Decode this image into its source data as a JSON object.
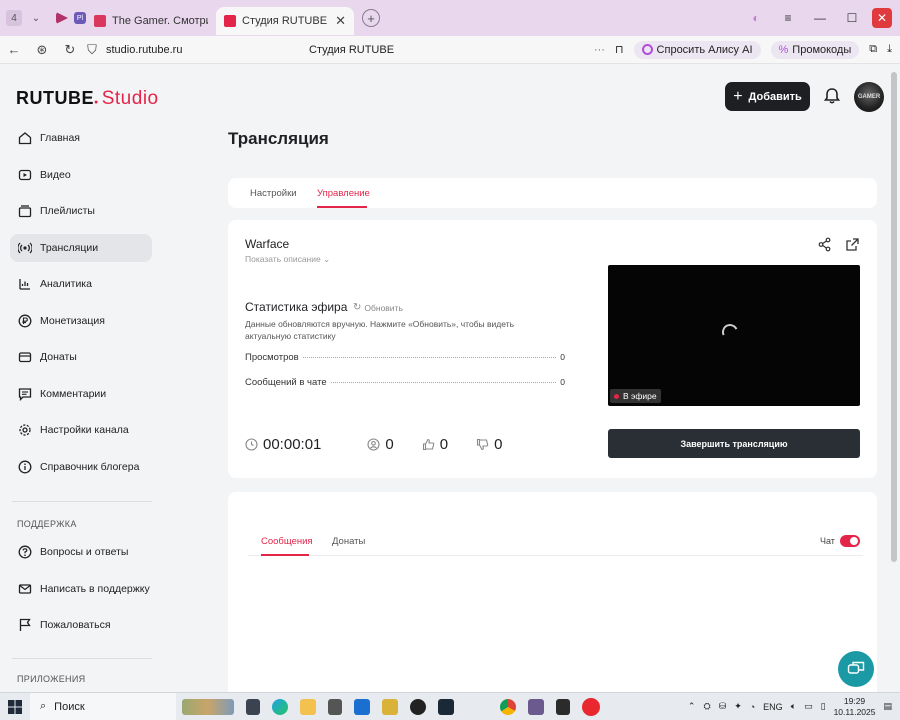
{
  "browser": {
    "tab_count": "4",
    "tabs": [
      {
        "title": "The Gamer. Смотрите вид",
        "color": "#d9385c"
      },
      {
        "title": "Студия RUTUBE",
        "color": "#e4254a"
      }
    ],
    "url": "studio.rutube.ru",
    "page_title": "Студия RUTUBE",
    "alice_label": "Спросить Алису AI",
    "promo_label": "Промокоды"
  },
  "header": {
    "logo_main": "RUTUBE",
    "logo_studio": "Studio",
    "add_button": "Добавить",
    "avatar_text": "GAMER"
  },
  "sidebar": {
    "items": [
      {
        "label": "Главная",
        "icon": "home-icon"
      },
      {
        "label": "Видео",
        "icon": "video-icon"
      },
      {
        "label": "Плейлисты",
        "icon": "playlist-icon"
      },
      {
        "label": "Трансляции",
        "icon": "broadcast-icon",
        "active": true
      },
      {
        "label": "Аналитика",
        "icon": "analytics-icon"
      },
      {
        "label": "Монетизация",
        "icon": "ruble-icon"
      },
      {
        "label": "Донаты",
        "icon": "donate-icon"
      },
      {
        "label": "Комментарии",
        "icon": "comment-icon"
      },
      {
        "label": "Настройки канала",
        "icon": "gear-icon"
      },
      {
        "label": "Справочник блогера",
        "icon": "info-icon"
      }
    ],
    "support_title": "ПОДДЕРЖКА",
    "support_items": [
      {
        "label": "Вопросы и ответы",
        "icon": "help-icon"
      },
      {
        "label": "Написать в поддержку",
        "icon": "mail-icon"
      },
      {
        "label": "Пожаловаться",
        "icon": "flag-icon"
      }
    ],
    "apps_title": "ПРИЛОЖЕНИЯ"
  },
  "main": {
    "title": "Трансляция",
    "tabs": [
      "Настройки",
      "Управление"
    ],
    "active_tab": "Управление",
    "stream": {
      "name": "Warface",
      "show_description": "Показать описание",
      "stats_title": "Статистика эфира",
      "refresh": "Обновить",
      "note": "Данные обновляются вручную. Нажмите «Обновить», чтобы видеть актуальную статистику",
      "rows": [
        {
          "label": "Просмотров",
          "value": "0"
        },
        {
          "label": "Сообщений в чате",
          "value": "0"
        }
      ],
      "live_badge": "В эфире",
      "end_button": "Завершить трансляцию",
      "timer": "00:00:01",
      "viewers": "0",
      "likes": "0",
      "dislikes": "0"
    },
    "chat": {
      "tabs": [
        "Сообщения",
        "Донаты"
      ],
      "active_tab": "Сообщения",
      "chat_label": "Чат",
      "chat_enabled": true
    }
  },
  "taskbar": {
    "search_label": "Поиск",
    "lang": "ENG",
    "time": "19:29",
    "date": "10.11.2025"
  },
  "colors": {
    "accent": "#e4254a",
    "dark_button": "#1e1f22",
    "end_button": "#2a2f36",
    "fab": "#1b9aa6"
  }
}
